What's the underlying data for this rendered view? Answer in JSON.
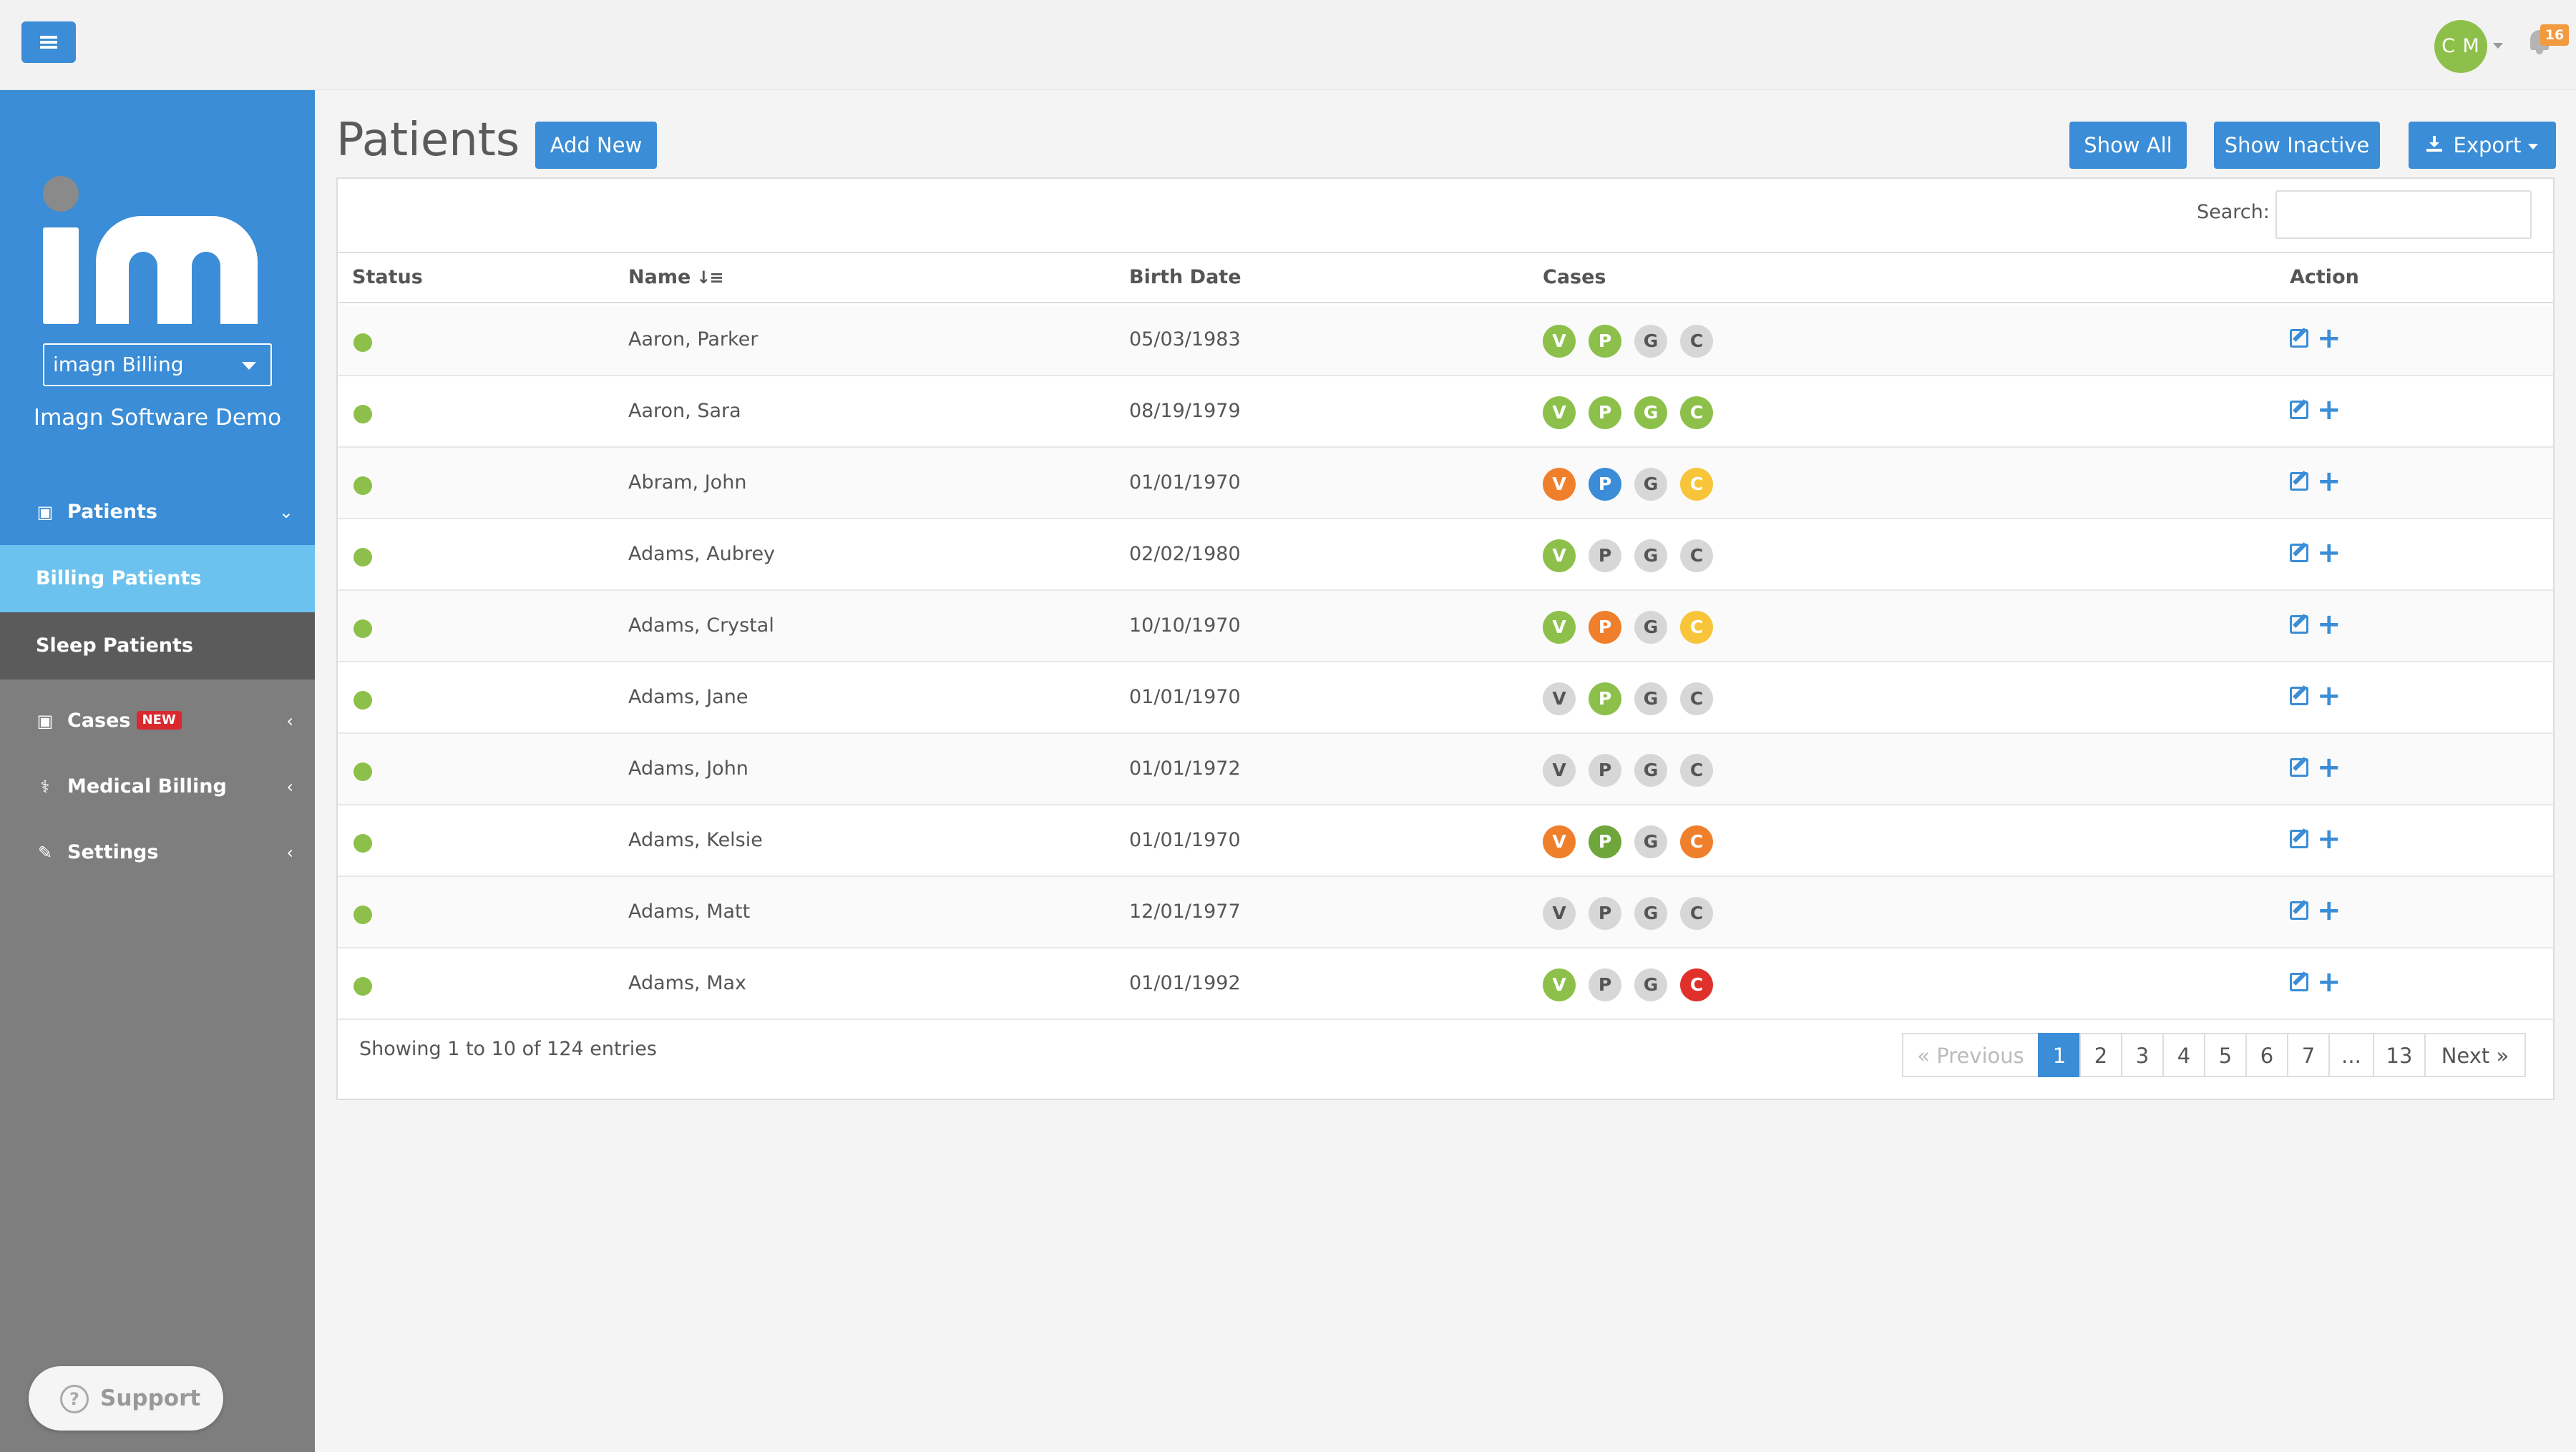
{
  "header": {
    "user_initials": "C M",
    "notification_count": "16"
  },
  "sidebar": {
    "org_select": "imagn Billing",
    "org_name": "Imagn Software Demo",
    "nav": {
      "patients": "Patients",
      "billing_patients": "Billing Patients",
      "sleep_patients": "Sleep Patients",
      "cases": "Cases",
      "cases_badge": "NEW",
      "medical_billing": "Medical Billing",
      "settings": "Settings"
    },
    "support": "Support"
  },
  "main": {
    "title": "Patients",
    "add_new": "Add New",
    "show_all": "Show All",
    "show_inactive": "Show Inactive",
    "export": "Export",
    "search_label": "Search:",
    "search_value": ""
  },
  "table": {
    "columns": {
      "status": "Status",
      "name": "Name",
      "birth": "Birth Date",
      "cases": "Cases",
      "action": "Action"
    },
    "case_colors": {
      "green": "#8dc04a",
      "darkgreen": "#6fa63c",
      "gray": "#d7d7d7",
      "orange": "#f07f2c",
      "blue": "#3a8dd6",
      "yellow": "#f8c53a",
      "red": "#e0302b"
    },
    "rows": [
      {
        "name": "Aaron, Parker",
        "birth": "05/03/1983",
        "cases": [
          [
            "V",
            "green"
          ],
          [
            "P",
            "green"
          ],
          [
            "G",
            "gray"
          ],
          [
            "C",
            "gray"
          ]
        ]
      },
      {
        "name": "Aaron, Sara",
        "birth": "08/19/1979",
        "cases": [
          [
            "V",
            "green"
          ],
          [
            "P",
            "green"
          ],
          [
            "G",
            "green"
          ],
          [
            "C",
            "green"
          ]
        ]
      },
      {
        "name": "Abram, John",
        "birth": "01/01/1970",
        "cases": [
          [
            "V",
            "orange"
          ],
          [
            "P",
            "blue"
          ],
          [
            "G",
            "gray"
          ],
          [
            "C",
            "yellow"
          ]
        ]
      },
      {
        "name": "Adams, Aubrey",
        "birth": "02/02/1980",
        "cases": [
          [
            "V",
            "green"
          ],
          [
            "P",
            "gray"
          ],
          [
            "G",
            "gray"
          ],
          [
            "C",
            "gray"
          ]
        ]
      },
      {
        "name": "Adams, Crystal",
        "birth": "10/10/1970",
        "cases": [
          [
            "V",
            "green"
          ],
          [
            "P",
            "orange"
          ],
          [
            "G",
            "gray"
          ],
          [
            "C",
            "yellow"
          ]
        ]
      },
      {
        "name": "Adams, Jane",
        "birth": "01/01/1970",
        "cases": [
          [
            "V",
            "gray"
          ],
          [
            "P",
            "green"
          ],
          [
            "G",
            "gray"
          ],
          [
            "C",
            "gray"
          ]
        ]
      },
      {
        "name": "Adams, John",
        "birth": "01/01/1972",
        "cases": [
          [
            "V",
            "gray"
          ],
          [
            "P",
            "gray"
          ],
          [
            "G",
            "gray"
          ],
          [
            "C",
            "gray"
          ]
        ]
      },
      {
        "name": "Adams, Kelsie",
        "birth": "01/01/1970",
        "cases": [
          [
            "V",
            "orange"
          ],
          [
            "P",
            "darkgreen"
          ],
          [
            "G",
            "gray"
          ],
          [
            "C",
            "orange"
          ]
        ]
      },
      {
        "name": "Adams, Matt",
        "birth": "12/01/1977",
        "cases": [
          [
            "V",
            "gray"
          ],
          [
            "P",
            "gray"
          ],
          [
            "G",
            "gray"
          ],
          [
            "C",
            "gray"
          ]
        ]
      },
      {
        "name": "Adams, Max",
        "birth": "01/01/1992",
        "cases": [
          [
            "V",
            "green"
          ],
          [
            "P",
            "gray"
          ],
          [
            "G",
            "gray"
          ],
          [
            "C",
            "red"
          ]
        ]
      }
    ]
  },
  "footer": {
    "info": "Showing 1 to 10 of 124 entries",
    "pagination": [
      "«  Previous",
      "1",
      "2",
      "3",
      "4",
      "5",
      "6",
      "7",
      "...",
      "13",
      "Next  »"
    ]
  }
}
